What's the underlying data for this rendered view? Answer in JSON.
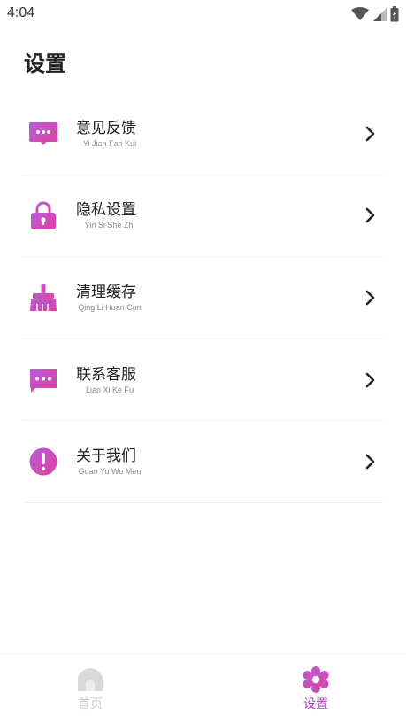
{
  "status_bar": {
    "time": "4:04",
    "icons": [
      "wifi-icon",
      "signal-icon",
      "battery-icon"
    ]
  },
  "page": {
    "title": "设置"
  },
  "menu": {
    "items": [
      {
        "title": "意见反馈",
        "subtitle": "Yi Jian Fan Kui",
        "icon": "feedback-icon"
      },
      {
        "title": "隐私设置",
        "subtitle": "Yin Si She Zhi",
        "icon": "lock-icon"
      },
      {
        "title": "清理缓存",
        "subtitle": "Qing Li Huan Cun",
        "icon": "broom-icon"
      },
      {
        "title": "联系客服",
        "subtitle": "Lian Xi Ke Fu",
        "icon": "chat-icon"
      },
      {
        "title": "关于我们",
        "subtitle": "Guan Yu Wo Men",
        "icon": "info-icon"
      }
    ]
  },
  "tabbar": {
    "home_label": "首页",
    "settings_label": "设置",
    "active": "settings"
  },
  "colors": {
    "accent": "#b23fc0",
    "gradient_start": "#c15ad6",
    "gradient_end": "#e2419a",
    "inactive_tab": "#c9c9c9"
  }
}
